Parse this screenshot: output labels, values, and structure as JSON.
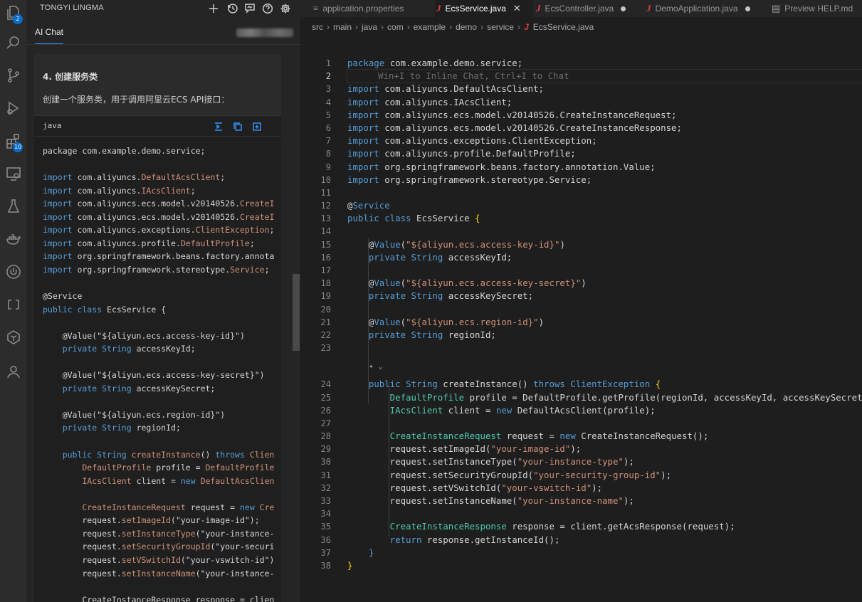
{
  "activity_bar": {
    "items": [
      {
        "name": "explorer-icon",
        "badge": "2"
      },
      {
        "name": "search-icon"
      },
      {
        "name": "source-control-icon"
      },
      {
        "name": "run-debug-icon"
      },
      {
        "name": "extensions-icon",
        "badge": "10"
      },
      {
        "name": "remote-explorer-icon"
      },
      {
        "name": "testing-icon"
      },
      {
        "name": "docker-icon"
      },
      {
        "name": "power-icon"
      },
      {
        "name": "codebrackets-icon"
      },
      {
        "name": "tongyi-icon"
      },
      {
        "name": "account-icon"
      }
    ]
  },
  "sidebar": {
    "title": "TONGYI LINGMA",
    "header_icons": [
      "add-icon",
      "history-icon",
      "feedback-icon",
      "help-icon",
      "settings-icon"
    ],
    "tab": "AI Chat",
    "chat": {
      "heading": "4. 创建服务类",
      "description": "创建一个服务类，用于调用阿里云ECS API接口：",
      "code_lang": "java",
      "code_actions": [
        "insert-icon",
        "copy-icon",
        "new-file-icon"
      ],
      "code_lines": [
        [
          [
            "package com.example.demo.service;",
            "id"
          ]
        ],
        [
          [
            "",
            "id"
          ]
        ],
        [
          [
            "import ",
            "kw"
          ],
          [
            "com.aliyuncs.",
            "id"
          ],
          [
            "DefaultAcsClient",
            "cl"
          ],
          [
            ";",
            "id"
          ]
        ],
        [
          [
            "import ",
            "kw"
          ],
          [
            "com.aliyuncs.",
            "id"
          ],
          [
            "IAcsClient",
            "cl"
          ],
          [
            ";",
            "id"
          ]
        ],
        [
          [
            "import ",
            "kw"
          ],
          [
            "com.aliyuncs.ecs.model.v20140526.",
            "id"
          ],
          [
            "CreateI",
            "cl"
          ]
        ],
        [
          [
            "import ",
            "kw"
          ],
          [
            "com.aliyuncs.ecs.model.v20140526.",
            "id"
          ],
          [
            "CreateI",
            "cl"
          ]
        ],
        [
          [
            "import ",
            "kw"
          ],
          [
            "com.aliyuncs.exceptions.",
            "id"
          ],
          [
            "ClientException",
            "cl"
          ],
          [
            ";",
            "id"
          ]
        ],
        [
          [
            "import ",
            "kw"
          ],
          [
            "com.aliyuncs.profile.",
            "id"
          ],
          [
            "DefaultProfile",
            "cl"
          ],
          [
            ";",
            "id"
          ]
        ],
        [
          [
            "import ",
            "kw"
          ],
          [
            "org.springframework.beans.factory.annota",
            "id"
          ]
        ],
        [
          [
            "import ",
            "kw"
          ],
          [
            "org.springframework.stereotype.",
            "id"
          ],
          [
            "Service",
            "cl"
          ],
          [
            ";",
            "id"
          ]
        ],
        [
          [
            "",
            "id"
          ]
        ],
        [
          [
            "@Service",
            "id"
          ]
        ],
        [
          [
            "public class ",
            "kw"
          ],
          [
            "EcsService {",
            "id"
          ]
        ],
        [
          [
            "",
            "id"
          ]
        ],
        [
          [
            "    @Value(\"${aliyun.ecs.access-key-id}\")",
            "id"
          ]
        ],
        [
          [
            "    private ",
            "kw"
          ],
          [
            "String ",
            "kw"
          ],
          [
            "accessKeyId;",
            "id"
          ]
        ],
        [
          [
            "",
            "id"
          ]
        ],
        [
          [
            "    @Value(\"${aliyun.ecs.access-key-secret}\")",
            "id"
          ]
        ],
        [
          [
            "    private ",
            "kw"
          ],
          [
            "String ",
            "kw"
          ],
          [
            "accessKeySecret;",
            "id"
          ]
        ],
        [
          [
            "",
            "id"
          ]
        ],
        [
          [
            "    @Value(\"${aliyun.ecs.region-id}\")",
            "id"
          ]
        ],
        [
          [
            "    private ",
            "kw"
          ],
          [
            "String ",
            "kw"
          ],
          [
            "regionId;",
            "id"
          ]
        ],
        [
          [
            "",
            "id"
          ]
        ],
        [
          [
            "    public ",
            "kw"
          ],
          [
            "String ",
            "kw"
          ],
          [
            "createInstance",
            "cl"
          ],
          [
            "() ",
            "id"
          ],
          [
            "throws ",
            "kw"
          ],
          [
            "Clien",
            "cl"
          ]
        ],
        [
          [
            "        DefaultProfile ",
            "cl"
          ],
          [
            "profile = ",
            "id"
          ],
          [
            "DefaultProfile",
            "cl"
          ]
        ],
        [
          [
            "        IAcsClient ",
            "cl"
          ],
          [
            "client = ",
            "id"
          ],
          [
            "new ",
            "kw"
          ],
          [
            "DefaultAcsClien",
            "cl"
          ]
        ],
        [
          [
            "",
            "id"
          ]
        ],
        [
          [
            "        CreateInstanceRequest ",
            "cl"
          ],
          [
            "request = ",
            "id"
          ],
          [
            "new ",
            "kw"
          ],
          [
            "Cre",
            "cl"
          ]
        ],
        [
          [
            "        request.",
            "id"
          ],
          [
            "setImageId",
            "cl"
          ],
          [
            "(\"your-image-id\");",
            "id"
          ]
        ],
        [
          [
            "        request.",
            "id"
          ],
          [
            "setInstanceType",
            "cl"
          ],
          [
            "(\"your-instance-",
            "id"
          ]
        ],
        [
          [
            "        request.",
            "id"
          ],
          [
            "setSecurityGroupId",
            "cl"
          ],
          [
            "(\"your-securi",
            "id"
          ]
        ],
        [
          [
            "        request.",
            "id"
          ],
          [
            "setVSwitchId",
            "cl"
          ],
          [
            "(\"your-vswitch-id\")",
            "id"
          ]
        ],
        [
          [
            "        request.",
            "id"
          ],
          [
            "setInstanceName",
            "cl"
          ],
          [
            "(\"your-instance-",
            "id"
          ]
        ],
        [
          [
            "",
            "id"
          ]
        ],
        [
          [
            "        CreateInstanceResponse response = clien",
            "id"
          ]
        ]
      ]
    }
  },
  "tabs": [
    {
      "label": "application.properties",
      "icon": "settings-file-icon",
      "modified": false,
      "active": false
    },
    {
      "label": "EcsService.java",
      "icon": "java-icon",
      "modified": false,
      "active": true
    },
    {
      "label": "EcsController.java",
      "icon": "java-icon",
      "modified": true,
      "active": false
    },
    {
      "label": "DemoApplication.java",
      "icon": "java-icon",
      "modified": true,
      "active": false
    },
    {
      "label": "Preview HELP.md",
      "icon": "preview-icon",
      "modified": false,
      "active": false
    }
  ],
  "breadcrumb": [
    "src",
    "main",
    "java",
    "com",
    "example",
    "demo",
    "service",
    "EcsService.java"
  ],
  "editor": {
    "current_line": 2,
    "inline_hint": "Win+I to Inline Chat, Ctrl+I to Chat",
    "lines": [
      {
        "n": 1,
        "tokens": [
          [
            "package ",
            "kw"
          ],
          [
            "com.example.demo.service;",
            "id"
          ]
        ]
      },
      {
        "n": 2,
        "hint": true
      },
      {
        "n": 3,
        "tokens": [
          [
            "import ",
            "kw"
          ],
          [
            "com.aliyuncs.DefaultAcsClient;",
            "id"
          ]
        ]
      },
      {
        "n": 4,
        "tokens": [
          [
            "import ",
            "kw"
          ],
          [
            "com.aliyuncs.IAcsClient;",
            "id"
          ]
        ]
      },
      {
        "n": 5,
        "tokens": [
          [
            "import ",
            "kw"
          ],
          [
            "com.aliyuncs.ecs.model.v20140526.CreateInstanceRequest;",
            "id"
          ]
        ]
      },
      {
        "n": 6,
        "tokens": [
          [
            "import ",
            "kw"
          ],
          [
            "com.aliyuncs.ecs.model.v20140526.CreateInstanceResponse;",
            "id"
          ]
        ]
      },
      {
        "n": 7,
        "tokens": [
          [
            "import ",
            "kw"
          ],
          [
            "com.aliyuncs.exceptions.ClientException;",
            "id"
          ]
        ]
      },
      {
        "n": 8,
        "tokens": [
          [
            "import ",
            "kw"
          ],
          [
            "com.aliyuncs.profile.DefaultProfile;",
            "id"
          ]
        ]
      },
      {
        "n": 9,
        "tokens": [
          [
            "import ",
            "kw"
          ],
          [
            "org.springframework.beans.factory.annotation.Value;",
            "id"
          ]
        ]
      },
      {
        "n": 10,
        "tokens": [
          [
            "import ",
            "kw"
          ],
          [
            "org.springframework.stereotype.Service;",
            "id"
          ]
        ]
      },
      {
        "n": 11,
        "tokens": []
      },
      {
        "n": 12,
        "tokens": [
          [
            "@",
            "id"
          ],
          [
            "Service",
            "kw"
          ]
        ]
      },
      {
        "n": 13,
        "tokens": [
          [
            "public class ",
            "kw"
          ],
          [
            "EcsService ",
            "id"
          ],
          [
            "{",
            "br"
          ]
        ]
      },
      {
        "n": 14,
        "tokens": []
      },
      {
        "n": 15,
        "tokens": [
          [
            "    @",
            "id"
          ],
          [
            "Value",
            "kw"
          ],
          [
            "(",
            "id"
          ],
          [
            "\"${aliyun.ecs.access-key-id}\"",
            "st"
          ],
          [
            ")",
            "id"
          ]
        ]
      },
      {
        "n": 16,
        "tokens": [
          [
            "    private ",
            "kw"
          ],
          [
            "String ",
            "kw"
          ],
          [
            "accessKeyId;",
            "id"
          ]
        ]
      },
      {
        "n": 17,
        "tokens": []
      },
      {
        "n": 18,
        "tokens": [
          [
            "    @",
            "id"
          ],
          [
            "Value",
            "kw"
          ],
          [
            "(",
            "id"
          ],
          [
            "\"${aliyun.ecs.access-key-secret}\"",
            "st"
          ],
          [
            ")",
            "id"
          ]
        ]
      },
      {
        "n": 19,
        "tokens": [
          [
            "    private ",
            "kw"
          ],
          [
            "String ",
            "kw"
          ],
          [
            "accessKeySecret;",
            "id"
          ]
        ]
      },
      {
        "n": 20,
        "tokens": []
      },
      {
        "n": 21,
        "tokens": [
          [
            "    @",
            "id"
          ],
          [
            "Value",
            "kw"
          ],
          [
            "(",
            "id"
          ],
          [
            "\"${aliyun.ecs.region-id}\"",
            "st"
          ],
          [
            ")",
            "id"
          ]
        ]
      },
      {
        "n": 22,
        "tokens": [
          [
            "    private ",
            "kw"
          ],
          [
            "String ",
            "kw"
          ],
          [
            "regionId;",
            "id"
          ]
        ]
      },
      {
        "n": 23,
        "tokens": []
      },
      {
        "n": 24,
        "lens": true,
        "tokens": [
          [
            "    public ",
            "kw"
          ],
          [
            "String ",
            "kw"
          ],
          [
            "createInstance",
            "id"
          ],
          [
            "() ",
            "id"
          ],
          [
            "throws ",
            "kw"
          ],
          [
            "ClientException ",
            "kw"
          ],
          [
            "{",
            "br"
          ]
        ]
      },
      {
        "n": 25,
        "tokens": [
          [
            "        DefaultProfile ",
            "kw"
          ],
          [
            "profile = DefaultProfile.getProfile(regionId, accessKeyId, accessKeySecret);",
            "id"
          ]
        ]
      },
      {
        "n": 26,
        "tokens": [
          [
            "        IAcsClient ",
            "kw"
          ],
          [
            "client = ",
            "id"
          ],
          [
            "new ",
            "kw"
          ],
          [
            "DefaultAcsClient(profile);",
            "id"
          ]
        ]
      },
      {
        "n": 27,
        "tokens": []
      },
      {
        "n": 28,
        "tokens": [
          [
            "        CreateInstanceRequest ",
            "kw"
          ],
          [
            "request = ",
            "id"
          ],
          [
            "new ",
            "kw"
          ],
          [
            "CreateInstanceRequest();",
            "id"
          ]
        ]
      },
      {
        "n": 29,
        "tokens": [
          [
            "        request.setImageId(",
            "id"
          ],
          [
            "\"your-image-id\"",
            "st"
          ],
          [
            ");",
            "id"
          ]
        ]
      },
      {
        "n": 30,
        "tokens": [
          [
            "        request.setInstanceType(",
            "id"
          ],
          [
            "\"your-instance-type\"",
            "st"
          ],
          [
            ");",
            "id"
          ]
        ]
      },
      {
        "n": 31,
        "tokens": [
          [
            "        request.setSecurityGroupId(",
            "id"
          ],
          [
            "\"your-security-group-id\"",
            "st"
          ],
          [
            ");",
            "id"
          ]
        ]
      },
      {
        "n": 32,
        "tokens": [
          [
            "        request.setVSwitchId(",
            "id"
          ],
          [
            "\"your-vswitch-id\"",
            "st"
          ],
          [
            ");",
            "id"
          ]
        ]
      },
      {
        "n": 33,
        "tokens": [
          [
            "        request.setInstanceName(",
            "id"
          ],
          [
            "\"your-instance-name\"",
            "st"
          ],
          [
            ");",
            "id"
          ]
        ]
      },
      {
        "n": 34,
        "tokens": []
      },
      {
        "n": 35,
        "tokens": [
          [
            "        CreateInstanceResponse ",
            "kw"
          ],
          [
            "response = client.getAcsResponse(request);",
            "id"
          ]
        ]
      },
      {
        "n": 36,
        "tokens": [
          [
            "        return ",
            "kw"
          ],
          [
            "response.getInstanceId();",
            "id"
          ]
        ]
      },
      {
        "n": 37,
        "tokens": [
          [
            "    }",
            "kw"
          ]
        ]
      },
      {
        "n": 38,
        "tokens": [
          [
            "}",
            "br"
          ]
        ]
      }
    ]
  }
}
